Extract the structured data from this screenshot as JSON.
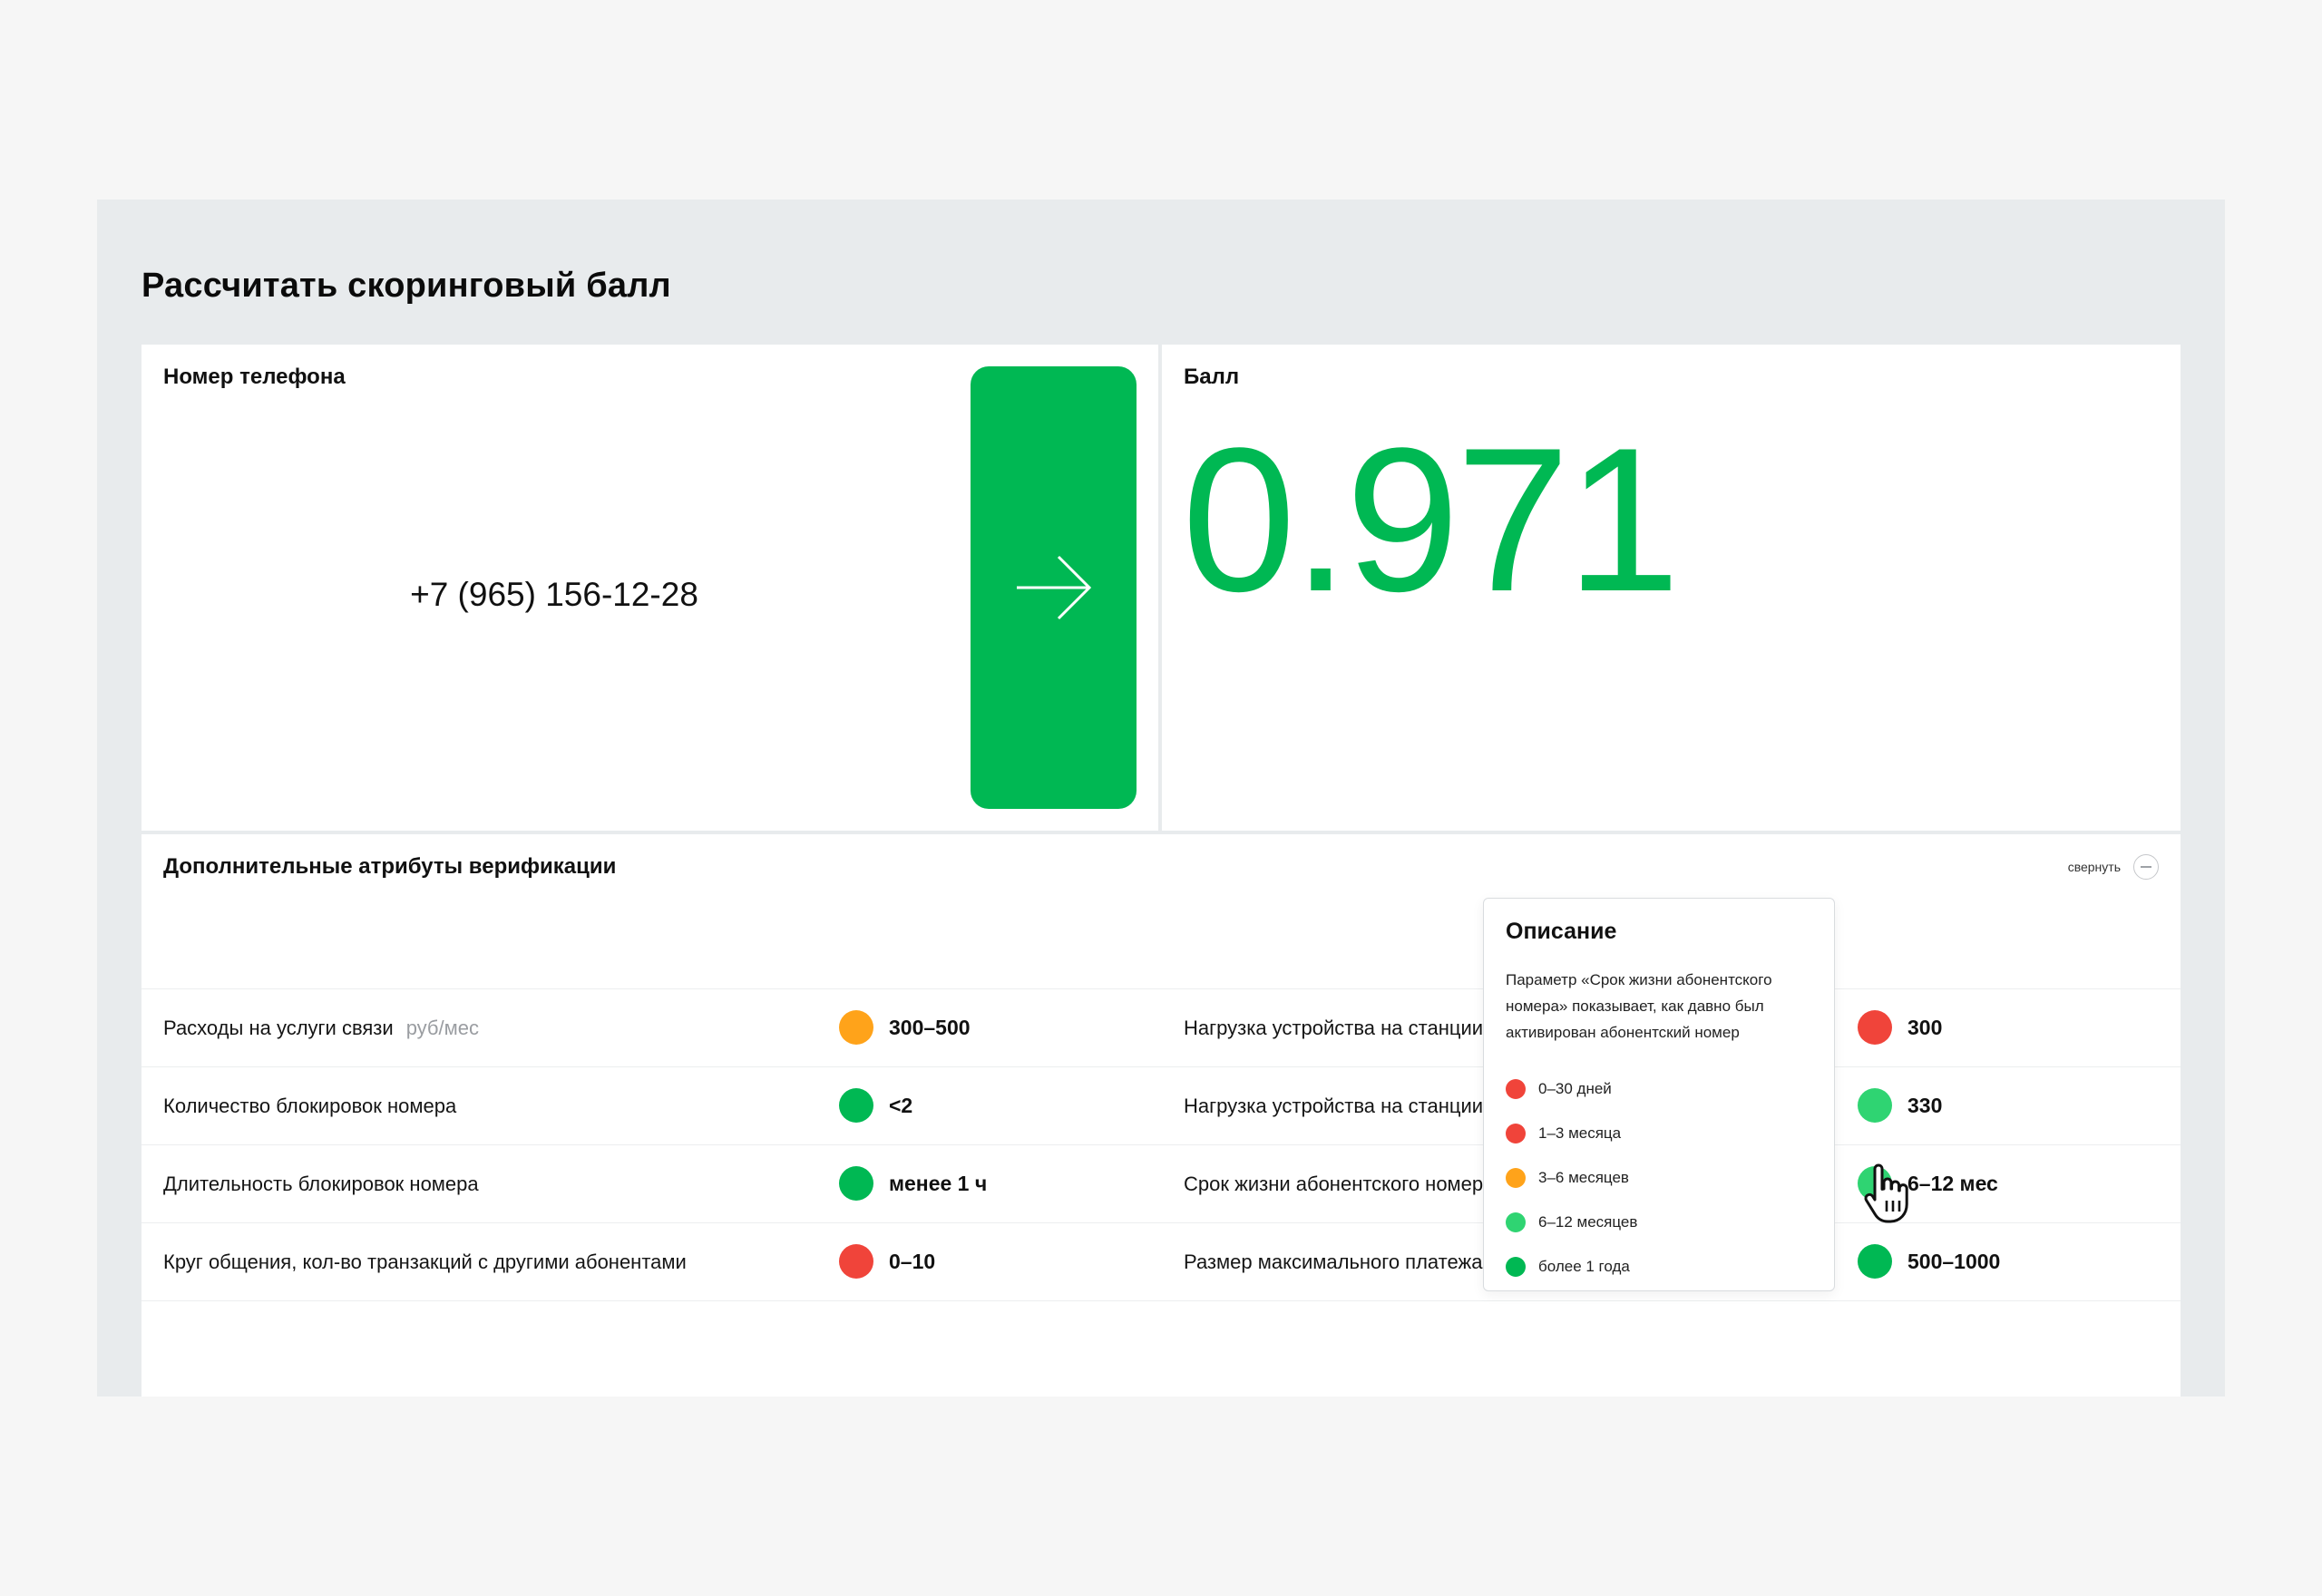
{
  "page": {
    "title": "Рассчитать скоринговый балл"
  },
  "phone_card": {
    "label": "Номер телефона",
    "value": "+7 (965) 156-12-28"
  },
  "score_card": {
    "label": "Балл",
    "value": "0.971"
  },
  "attributes": {
    "title": "Дополнительные атрибуты верификации",
    "collapse_label": "свернуть",
    "rows": [
      {
        "left": {
          "label": "Расходы на услуги связи",
          "unit": "руб/мес",
          "value": "300–500",
          "color": "#ffa31a"
        },
        "right": {
          "label": "Нагрузка устройства на станции",
          "value": "300",
          "color": "#f0443a"
        }
      },
      {
        "left": {
          "label": "Количество блокировок номера",
          "value": "<2",
          "color": "#00b853"
        },
        "right": {
          "label": "Нагрузка устройства на станции",
          "value": "330",
          "color": "#2fd472"
        }
      },
      {
        "left": {
          "label": "Длительность блокировок номера",
          "value": "менее 1 ч",
          "color": "#00b853"
        },
        "right": {
          "label": "Срок жизни абонентского номера",
          "value": "6–12 мес",
          "color": "#2fd472"
        }
      },
      {
        "left": {
          "label": "Круг общения, кол-во транзакций с другими абонентами",
          "value": "0–10",
          "color": "#f0443a"
        },
        "right": {
          "label": "Размер максимального платежа",
          "value": "500–1000",
          "color": "#00b853"
        }
      }
    ]
  },
  "tooltip": {
    "title": "Описание",
    "text": "Параметр «Срок жизни абонентского номера» показывает, как давно был активирован абонентский номер",
    "legend": [
      {
        "label": "0–30 дней",
        "color": "#f0443a"
      },
      {
        "label": "1–3 месяца",
        "color": "#f0443a"
      },
      {
        "label": "3–6 месяцев",
        "color": "#ffa31a"
      },
      {
        "label": "6–12 месяцев",
        "color": "#2fd472"
      },
      {
        "label": "более 1 года",
        "color": "#00b853"
      }
    ]
  },
  "icons": {
    "go_button": "arrow-right-icon",
    "collapse": "minus-circle-icon",
    "cursor": "hand-pointer-icon"
  }
}
